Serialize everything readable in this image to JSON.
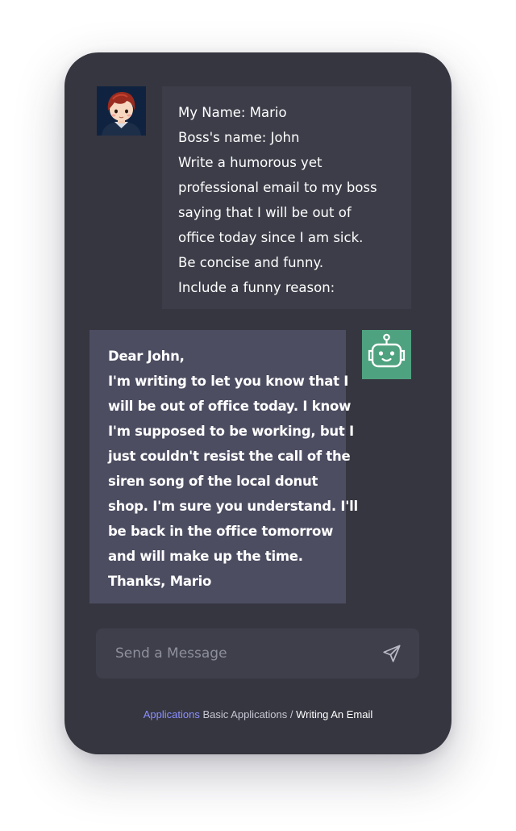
{
  "chat": {
    "user_message": [
      "My Name: Mario",
      "Boss's name: John",
      "Write a humorous yet",
      "professional email to my boss",
      "saying that I will be out of",
      "office today since I am sick.",
      "Be concise and funny.",
      "Include a funny reason:"
    ],
    "bot_message": [
      "Dear John,",
      "I'm writing to let you know that I",
      "will be out of office today. I know",
      "I'm supposed to be working, but I",
      "just couldn't resist the call of the",
      "siren song of the local donut",
      "shop. I'm sure you understand. I'll",
      "be back in the office tomorrow",
      "and will make up the time.",
      "Thanks, Mario"
    ]
  },
  "composer": {
    "placeholder": "Send a Message",
    "send_icon": "send-icon"
  },
  "breadcrumb": {
    "root": "Applications",
    "section": "Basic Applications",
    "separator": " / ",
    "current": "Writing An Email"
  },
  "colors": {
    "card_bg": "#363640",
    "user_bubble": "#3c3d48",
    "bot_bubble": "#4c4d61",
    "bot_avatar": "#4fa27f",
    "accent_link": "#8b90ff"
  }
}
